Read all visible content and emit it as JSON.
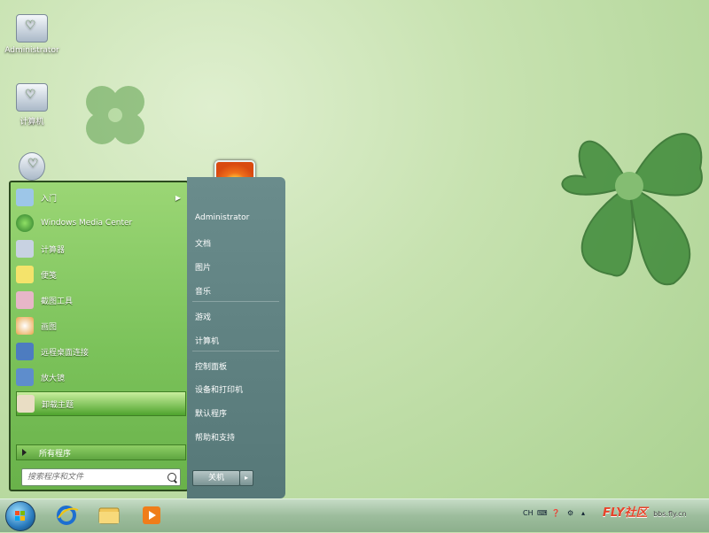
{
  "desktop": {
    "icons": [
      {
        "label": "Administrator"
      },
      {
        "label": "计算机"
      },
      {
        "label": ""
      }
    ]
  },
  "start_menu": {
    "programs": [
      {
        "label": "入门",
        "has_arrow": true
      },
      {
        "label": "Windows Media Center"
      },
      {
        "label": "计算器"
      },
      {
        "label": "便笺"
      },
      {
        "label": "截图工具"
      },
      {
        "label": "画图"
      },
      {
        "label": "远程桌面连接"
      },
      {
        "label": "放大镜"
      },
      {
        "label": "卸载主题",
        "selected": true
      }
    ],
    "all_programs": "所有程序",
    "search_placeholder": "搜索程序和文件",
    "right_items": [
      {
        "label": "Administrator"
      },
      {
        "label": "文档"
      },
      {
        "label": "图片"
      },
      {
        "label": "音乐"
      },
      {
        "label": "游戏"
      },
      {
        "label": "计算机"
      },
      {
        "label": "控制面板"
      },
      {
        "label": "设备和打印机"
      },
      {
        "label": "默认程序"
      },
      {
        "label": "帮助和支持"
      }
    ],
    "shutdown_label": "关机",
    "shutdown_arrow": "▸"
  },
  "taskbar": {
    "language": "CH",
    "watermark": "FLY社区",
    "watermark_sub": "bbs.fly.cn"
  },
  "colors": {
    "accent": "#7bc25a",
    "right_pane": "#567878"
  }
}
